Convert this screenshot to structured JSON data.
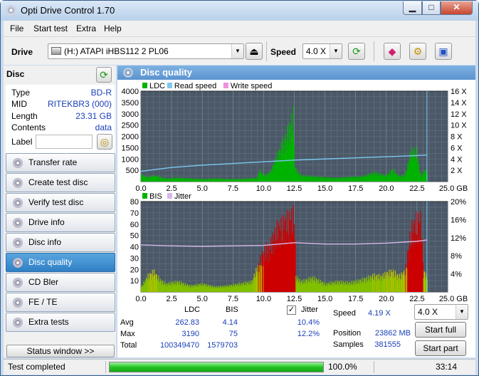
{
  "window": {
    "title": "Opti Drive Control 1.70",
    "min": "▁",
    "max": "□",
    "close": "✕"
  },
  "menu": [
    "File",
    "Start test",
    "Extra",
    "Help"
  ],
  "toolbar": {
    "drive_label": "Drive",
    "drive_value": "(H:)   ATAPI iHBS112   2 PL06",
    "speed_label": "Speed",
    "speed_value": "4.0 X"
  },
  "disc": {
    "header": "Disc",
    "rows": [
      {
        "label": "Type",
        "value": "BD-R"
      },
      {
        "label": "MID",
        "value": "RITEKBR3 (000)"
      },
      {
        "label": "Length",
        "value": "23.31 GB"
      },
      {
        "label": "Contents",
        "value": "data"
      }
    ],
    "label_label": "Label"
  },
  "nav": [
    {
      "label": "Transfer rate",
      "active": false
    },
    {
      "label": "Create test disc",
      "active": false
    },
    {
      "label": "Verify test disc",
      "active": false
    },
    {
      "label": "Drive info",
      "active": false
    },
    {
      "label": "Disc info",
      "active": false
    },
    {
      "label": "Disc quality",
      "active": true
    },
    {
      "label": "CD Bler",
      "active": false
    },
    {
      "label": "FE / TE",
      "active": false
    },
    {
      "label": "Extra tests",
      "active": false
    }
  ],
  "status_window_button": "Status window >>",
  "section_title": "Disc quality",
  "colors": {
    "ldc": "#00b300",
    "read_speed": "#7cc8f0",
    "write_speed": "#f090e0",
    "bis": "#cc0000",
    "jitter": "#d8b8e8",
    "plot_bg": "#4a5868"
  },
  "chart_data": [
    {
      "type": "area",
      "legend": [
        "LDC",
        "Read speed",
        "Write speed"
      ],
      "x_ticks": [
        "0.0",
        "2.5",
        "5.0",
        "7.5",
        "10.0",
        "12.5",
        "15.0",
        "17.5",
        "20.0",
        "22.5",
        "25.0 GB"
      ],
      "y_ticks_left": [
        "4000",
        "3500",
        "3000",
        "2500",
        "2000",
        "1500",
        "1000",
        "500"
      ],
      "y_ticks_right": [
        "16 X",
        "14 X",
        "12 X",
        "10 X",
        "8 X",
        "6 X",
        "4 X",
        "2 X"
      ],
      "xlim": [
        0,
        25
      ],
      "ylim": [
        0,
        4000
      ],
      "y2lim": [
        0,
        16
      ],
      "series": [
        {
          "name": "LDC",
          "x": [
            0,
            0.5,
            1,
            2,
            3,
            4,
            5,
            6,
            7,
            8,
            9,
            9.5,
            9.6,
            10,
            10.5,
            11,
            11.5,
            12,
            12.4,
            12.5,
            13,
            14,
            15,
            16,
            17,
            18,
            19,
            19.5,
            20,
            20.5,
            21,
            21.5,
            22,
            22.4,
            22.8,
            23,
            23.3,
            23.31
          ],
          "y": [
            350,
            200,
            300,
            150,
            180,
            150,
            120,
            150,
            120,
            130,
            150,
            200,
            600,
            300,
            450,
            1200,
            1800,
            2500,
            3200,
            700,
            300,
            250,
            200,
            180,
            220,
            250,
            450,
            350,
            300,
            600,
            250,
            350,
            1500,
            1500,
            200,
            500,
            600,
            400
          ]
        },
        {
          "name": "Read speed",
          "x": [
            0,
            1,
            2.5,
            5,
            7.5,
            10,
            12.5,
            15,
            17.5,
            20,
            22.5,
            23.31
          ],
          "y": [
            1.8,
            2.1,
            2.5,
            2.9,
            3.2,
            3.5,
            3.8,
            4.0,
            4.2,
            4.4,
            4.6,
            4.7
          ]
        }
      ],
      "marker_x": 23.31
    },
    {
      "type": "area",
      "legend": [
        "BIS",
        "Jitter"
      ],
      "x_ticks": [
        "0.0",
        "2.5",
        "5.0",
        "7.5",
        "10.0",
        "12.5",
        "15.0",
        "17.5",
        "20.0",
        "22.5",
        "25.0 GB"
      ],
      "y_ticks_left": [
        "80",
        "70",
        "60",
        "50",
        "40",
        "30",
        "20",
        "10"
      ],
      "y_ticks_right": [
        "20%",
        "16%",
        "12%",
        "8%",
        "4%"
      ],
      "xlim": [
        0,
        25
      ],
      "ylim": [
        0,
        80
      ],
      "y2lim": [
        0,
        20
      ],
      "series": [
        {
          "name": "BIS",
          "x": [
            0,
            0.5,
            1,
            1.5,
            2,
            3,
            4,
            5,
            6,
            7,
            8,
            9,
            9.5,
            10,
            10.5,
            11,
            11.5,
            12,
            12.5,
            12.6,
            13,
            14,
            15,
            16,
            17,
            18,
            19,
            19.5,
            20,
            20.5,
            21,
            21.5,
            22,
            22.4,
            22.8,
            23,
            23.31
          ],
          "y": [
            5,
            15,
            20,
            12,
            8,
            10,
            6,
            8,
            5,
            6,
            8,
            10,
            25,
            40,
            45,
            60,
            65,
            70,
            75,
            15,
            10,
            14,
            8,
            10,
            9,
            12,
            16,
            15,
            18,
            20,
            15,
            20,
            60,
            68,
            70,
            20,
            15
          ]
        },
        {
          "name": "Jitter",
          "x": [
            0,
            2.5,
            5,
            7.5,
            10,
            12.5,
            15,
            17.5,
            20,
            22.5,
            23.31
          ],
          "y": [
            10.4,
            10.2,
            10.1,
            10.2,
            10.3,
            10.9,
            10.6,
            10.6,
            10.8,
            11.2,
            11.5
          ]
        }
      ],
      "marker_x": 23.31
    }
  ],
  "stats": {
    "col_ldc": "LDC",
    "col_bis": "BIS",
    "col_jitter": "Jitter",
    "rows": [
      {
        "label": "Avg",
        "ldc": "262.83",
        "bis": "4.14",
        "jitter": "10.4%"
      },
      {
        "label": "Max",
        "ldc": "3190",
        "bis": "75",
        "jitter": "12.2%"
      },
      {
        "label": "Total",
        "ldc": "100349470",
        "bis": "1579703",
        "jitter": ""
      }
    ],
    "jitter_checked": true,
    "speed_label": "Speed",
    "speed_value": "4.19 X",
    "position_label": "Position",
    "position_value": "23862 MB",
    "samples_label": "Samples",
    "samples_value": "381555",
    "speed_select": "4.0 X",
    "start_full": "Start full",
    "start_part": "Start part"
  },
  "statusbar": {
    "text": "Test completed",
    "progress": 100.0,
    "progress_text": "100.0%",
    "time": "33:14"
  }
}
